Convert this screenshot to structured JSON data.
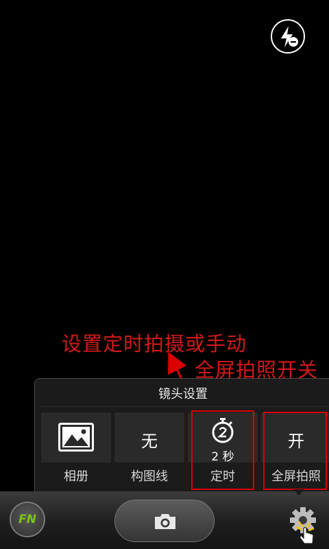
{
  "flash": {
    "icon": "flash-off-icon"
  },
  "annotations": {
    "timer_label": "设置定时拍摄或手动",
    "fullscreen_label": "全屏拍照开关"
  },
  "panel": {
    "title": "镜头设置",
    "tiles": [
      {
        "label": "相册",
        "icon": "gallery-icon"
      },
      {
        "label": "构图线",
        "value": "无"
      },
      {
        "label": "定时",
        "icon": "timer-icon",
        "value": "2 秒"
      },
      {
        "label": "全屏拍照",
        "value": "开"
      }
    ]
  },
  "bottom_bar": {
    "fn_label": "FN",
    "shutter_icon": "camera-icon",
    "settings_icon": "gear-icon"
  },
  "colors": {
    "annotation": "#d21a1a",
    "fn_text": "#7bc414"
  }
}
